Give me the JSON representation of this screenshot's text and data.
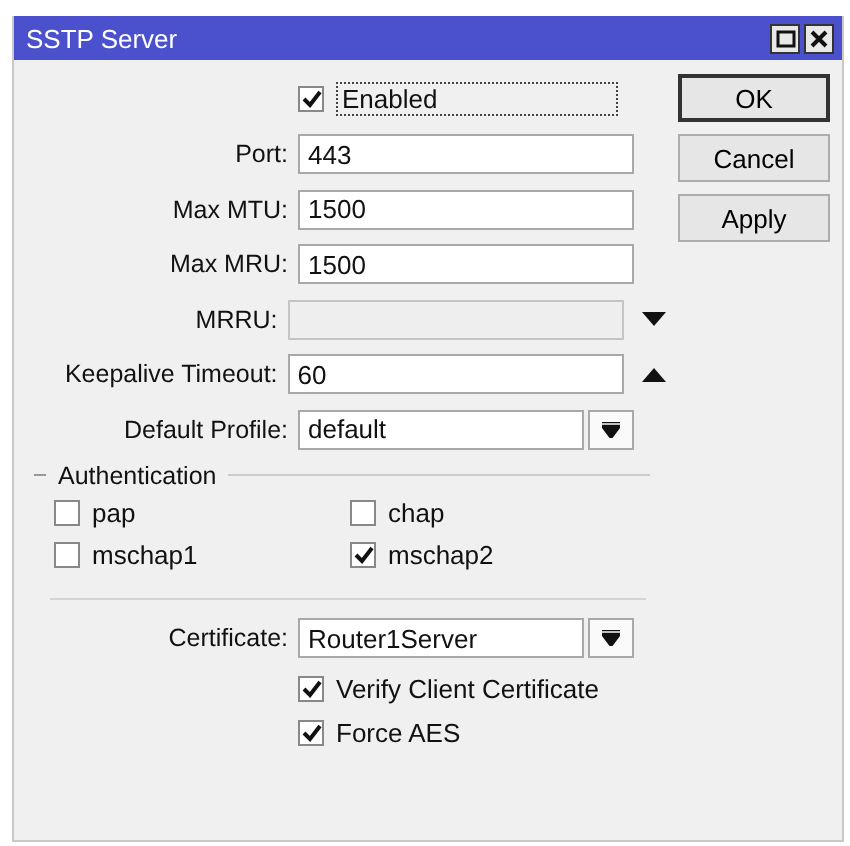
{
  "window": {
    "title": "SSTP Server"
  },
  "enabled": {
    "label": "Enabled",
    "checked": true
  },
  "fields": [
    {
      "kind": "input",
      "label": "Port:",
      "value": "443",
      "disabled": false
    },
    {
      "kind": "input",
      "label": "Max MTU:",
      "value": "1500",
      "disabled": false
    },
    {
      "kind": "input",
      "label": "Max MRU:",
      "value": "1500",
      "disabled": false
    },
    {
      "kind": "toggle",
      "label": "MRRU:",
      "disabled": true,
      "expanded": false
    },
    {
      "kind": "toggle",
      "label": "Keepalive Timeout:",
      "value": "60",
      "disabled": false,
      "expanded": true
    },
    {
      "kind": "select",
      "label": "Default Profile:",
      "value": "default",
      "disabled": false
    }
  ],
  "authentication": {
    "title": "Authentication",
    "options": [
      {
        "label": "pap",
        "checked": false
      },
      {
        "label": "chap",
        "checked": false
      },
      {
        "label": "mschap1",
        "checked": false
      },
      {
        "label": "mschap2",
        "checked": true
      }
    ]
  },
  "certificate": {
    "kind": "select",
    "label": "Certificate:",
    "value": "Router1Server",
    "disabled": false
  },
  "options": [
    {
      "label": "Verify Client Certificate",
      "checked": true
    },
    {
      "label": "Force AES",
      "checked": true
    }
  ],
  "buttons": [
    "OK",
    "Cancel",
    "Apply"
  ]
}
